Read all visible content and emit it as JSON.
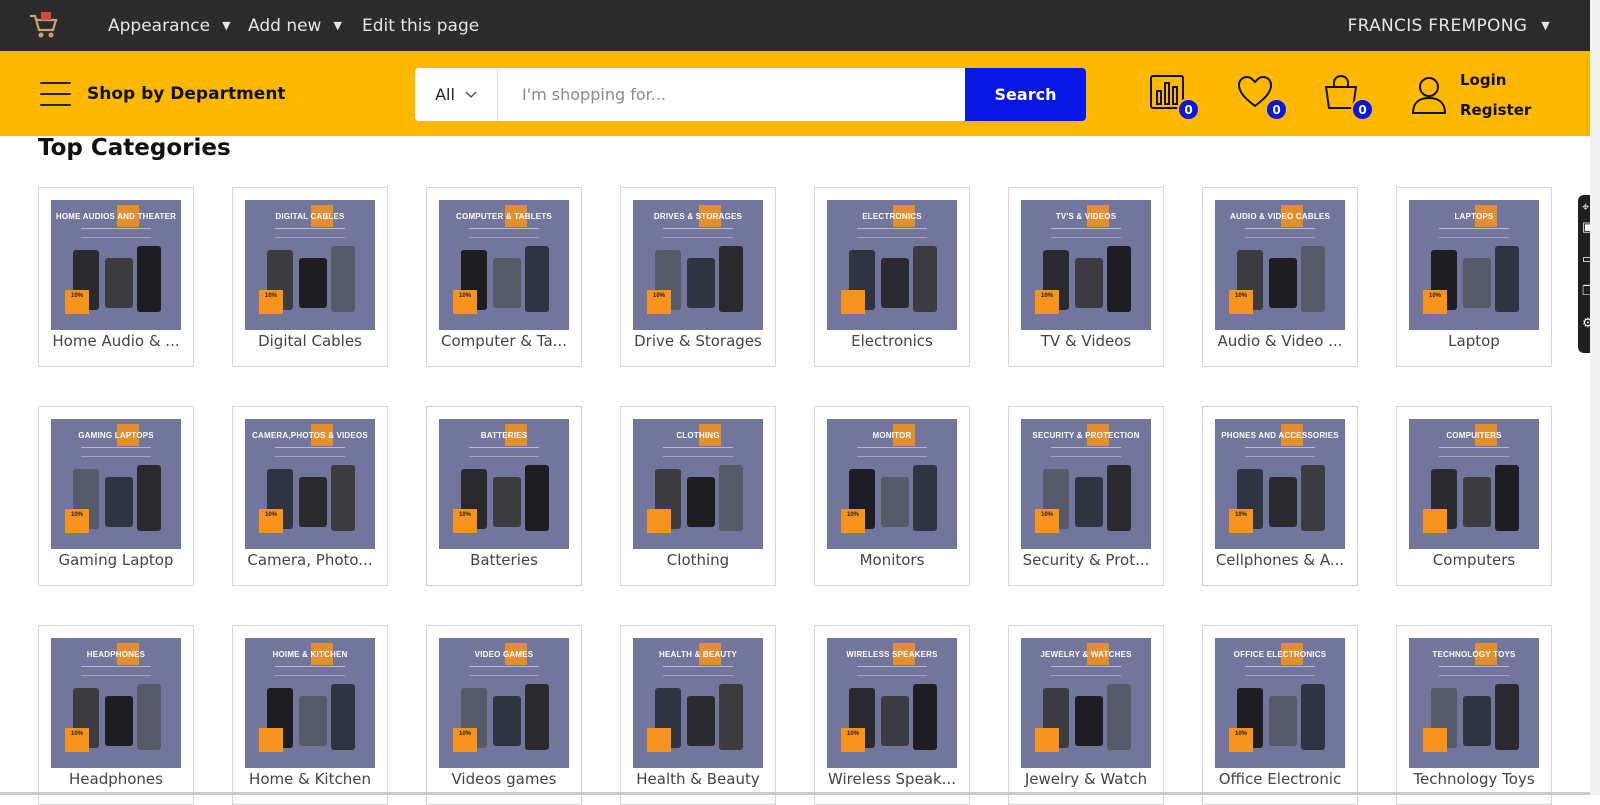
{
  "adminbar": {
    "menu": [
      {
        "label": "Appearance",
        "caret": true
      },
      {
        "label": "Add new",
        "caret": true
      },
      {
        "label": "Edit this page",
        "caret": false
      }
    ],
    "user_name": "FRANCIS FREMPONG"
  },
  "header": {
    "department_label": "Shop by Department",
    "search": {
      "category": "All",
      "placeholder": "I'm shopping for...",
      "button_label": "Search"
    },
    "compare_count": "0",
    "wishlist_count": "0",
    "cart_count": "0",
    "account": {
      "login": "Login",
      "register": "Register"
    },
    "brand_color": "#ffb800",
    "accent_color": "#0a16e6"
  },
  "section_title": "Top Categories",
  "categories": [
    {
      "label": "Home Audio & ...",
      "banner": "HOME AUDIOS AND THEATER",
      "discount": "10%"
    },
    {
      "label": "Digital Cables",
      "banner": "DIGITAL CABLES",
      "discount": "10%"
    },
    {
      "label": "Computer & Ta...",
      "banner": "COMPUTER & TABLETS",
      "discount": "10%"
    },
    {
      "label": "Drive & Storages",
      "banner": "DRIVES & STORAGES",
      "discount": "10%"
    },
    {
      "label": "Electronics",
      "banner": "ELECTRONICS",
      "discount": ""
    },
    {
      "label": "TV & Videos",
      "banner": "TV'S & VIDEOS",
      "discount": "10%"
    },
    {
      "label": "Audio & Video ...",
      "banner": "AUDIO & VIDEO CABLES",
      "discount": "10%"
    },
    {
      "label": "Laptop",
      "banner": "LAPTOPS",
      "discount": "10%"
    },
    {
      "label": "Gaming Laptop",
      "banner": "GAMING LAPTOPS",
      "discount": "10%"
    },
    {
      "label": "Camera, Photo...",
      "banner": "CAMERA,PHOTOS & VIDEOS",
      "discount": "10%"
    },
    {
      "label": "Batteries",
      "banner": "BATTERIES",
      "discount": "10%"
    },
    {
      "label": "Clothing",
      "banner": "CLOTHING",
      "discount": ""
    },
    {
      "label": "Monitors",
      "banner": "MONITOR",
      "discount": "10%"
    },
    {
      "label": "Security & Prot...",
      "banner": "SECURITY & PROTECTION",
      "discount": "10%"
    },
    {
      "label": "Cellphones & A...",
      "banner": "PHONES AND ACCESSORIES",
      "discount": "10%"
    },
    {
      "label": "Computers",
      "banner": "COMPUITERS",
      "discount": ""
    },
    {
      "label": "Headphones",
      "banner": "HEADPHONES",
      "discount": "10%"
    },
    {
      "label": "Home & Kitchen",
      "banner": "HOIME & KITCHEN",
      "discount": ""
    },
    {
      "label": "Videos games",
      "banner": "VIDEO GAMES",
      "discount": "10%"
    },
    {
      "label": "Health & Beauty",
      "banner": "HEALTH & BEAUTY",
      "discount": ""
    },
    {
      "label": "Wireless Speak...",
      "banner": "WIRELESS SPEAKERS",
      "discount": "10%"
    },
    {
      "label": "Jewelry & Watch",
      "banner": "JEWELRY & WATCHES",
      "discount": ""
    },
    {
      "label": "Office Electronic",
      "banner": "OFFICE ELECTRONICS",
      "discount": "10%"
    },
    {
      "label": "Technology Toys",
      "banner": "TECHNOLOGY TOYS",
      "discount": ""
    }
  ],
  "tile_color": "#72759c",
  "promo_color": "#f7941d"
}
